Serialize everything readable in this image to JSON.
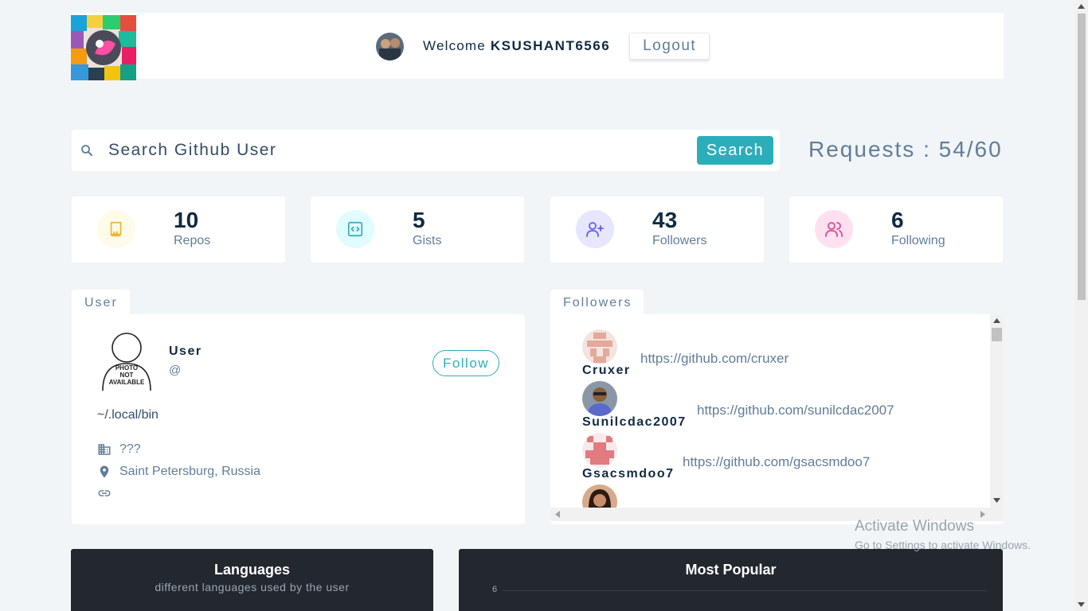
{
  "header": {
    "welcome_prefix": "Welcome",
    "username": "KSUSHANT6566",
    "logout_label": "Logout"
  },
  "search": {
    "placeholder": "Search Github User",
    "button_label": "Search",
    "requests_text": "Requests : 54/60"
  },
  "stats": [
    {
      "value": "10",
      "label": "Repos",
      "icon": "book-icon",
      "color": "#f0b429",
      "bg": "#fffbea"
    },
    {
      "value": "5",
      "label": "Gists",
      "icon": "code-icon",
      "color": "#2caeba",
      "bg": "#e0fcff"
    },
    {
      "value": "43",
      "label": "Followers",
      "icon": "user-plus-icon",
      "color": "#645cff",
      "bg": "#e6e6ff"
    },
    {
      "value": "6",
      "label": "Following",
      "icon": "users-icon",
      "color": "#da4a91",
      "bg": "#ffe0f0"
    }
  ],
  "user": {
    "tab_label": "User",
    "name": "User",
    "handle": "@",
    "follow_label": "Follow",
    "bio": "~/.local/bin",
    "company": "???",
    "location": "Saint Petersburg, Russia",
    "blog": "",
    "photo_text": [
      "PHOTO",
      "NOT",
      "AVAILABLE"
    ]
  },
  "followers": {
    "tab_label": "Followers",
    "items": [
      {
        "name": "Cruxer",
        "url": "https://github.com/cruxer"
      },
      {
        "name": "Sunilcdac2007",
        "url": "https://github.com/sunilcdac2007"
      },
      {
        "name": "Gsacsmdoo7",
        "url": "https://github.com/gsacsmdoo7"
      }
    ]
  },
  "charts": {
    "languages": {
      "title": "Languages",
      "subtitle": "different languages used by the user"
    },
    "popular": {
      "title": "Most Popular",
      "first_tick": "6"
    }
  },
  "watermark": {
    "line1": "Activate Windows",
    "line2": "Go to Settings to activate Windows."
  },
  "colors": {
    "accent": "#2caeba",
    "dark_panel": "#23272e"
  }
}
